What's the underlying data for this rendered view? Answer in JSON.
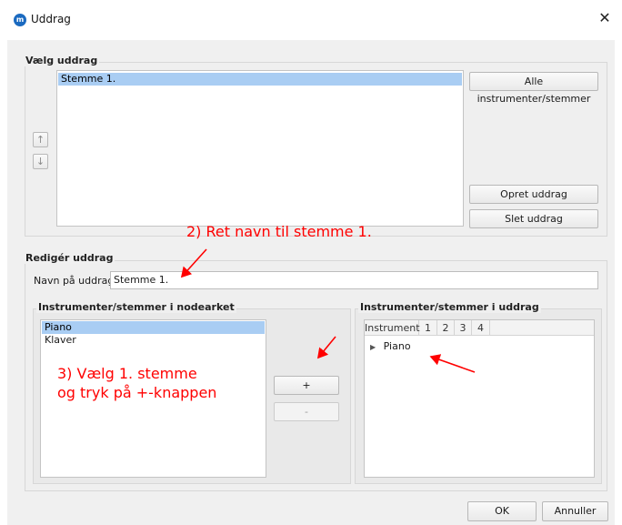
{
  "window": {
    "title": "Uddrag",
    "icon": "musescore-logo-icon"
  },
  "select_excerpt": {
    "legend": "Vælg uddrag",
    "items": [
      {
        "label": "Stemme 1.",
        "selected": true
      }
    ],
    "all_button": "Alle instrumenter/stemmer",
    "create_button": "Opret uddrag",
    "delete_button": "Slet uddrag",
    "move_up_icon": "arrow-up-icon",
    "move_down_icon": "arrow-down-icon"
  },
  "edit_excerpt": {
    "legend": "Redigér uddrag",
    "name_label": "Navn på uddrag:",
    "name_value": "Stemme 1.",
    "score_parts": {
      "title": "Instrumenter/stemmer i nodearket",
      "items": [
        {
          "label": "Piano",
          "selected": true
        },
        {
          "label": "Klaver",
          "selected": false
        }
      ]
    },
    "add_button": "+",
    "remove_button": "-",
    "excerpt_parts": {
      "title": "Instrumenter/stemmer i uddrag",
      "columns": [
        "Instrument",
        "1",
        "2",
        "3",
        "4"
      ],
      "rows": [
        {
          "label": "Piano"
        }
      ]
    }
  },
  "footer": {
    "ok": "OK",
    "cancel": "Annuller"
  },
  "annotations": {
    "step2": "2) Ret navn til stemme 1.",
    "step3_line1": "3) Vælg 1. stemme",
    "step3_line2": "og tryk på +-knappen",
    "color": "#ff0000"
  }
}
